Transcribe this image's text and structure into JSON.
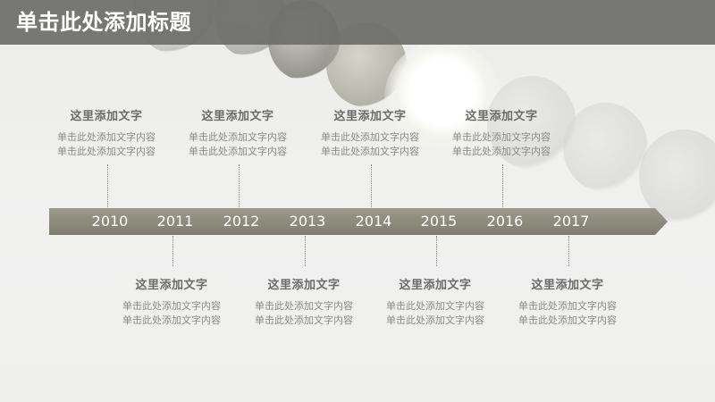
{
  "header": {
    "title": "单击此处添加标题"
  },
  "timeline": {
    "years": [
      "2010",
      "2011",
      "2012",
      "2013",
      "2014",
      "2015",
      "2016",
      "2017"
    ],
    "events": [
      {
        "title": "这里添加文字",
        "line1": "单击此处添加文字内容",
        "line2": "单击此处添加文字内容"
      },
      {
        "title": "这里添加文字",
        "line1": "单击此处添加文字内容",
        "line2": "单击此处添加文字内容"
      },
      {
        "title": "这里添加文字",
        "line1": "单击此处添加文字内容",
        "line2": "单击此处添加文字内容"
      },
      {
        "title": "这里添加文字",
        "line1": "单击此处添加文字内容",
        "line2": "单击此处添加文字内容"
      },
      {
        "title": "这里添加文字",
        "line1": "单击此处添加文字内容",
        "line2": "单击此处添加文字内容"
      },
      {
        "title": "这里添加文字",
        "line1": "单击此处添加文字内容",
        "line2": "单击此处添加文字内容"
      },
      {
        "title": "这里添加文字",
        "line1": "单击此处添加文字内容",
        "line2": "单击此处添加文字内容"
      },
      {
        "title": "这里添加文字",
        "line1": "单击此处添加文字内容",
        "line2": "单击此处添加文字内容"
      }
    ]
  },
  "colors": {
    "title_bar": "#6e6e6a",
    "arrow": "#8b8a7a",
    "card_title": "#6b6b68",
    "card_text": "#8a8a86"
  }
}
